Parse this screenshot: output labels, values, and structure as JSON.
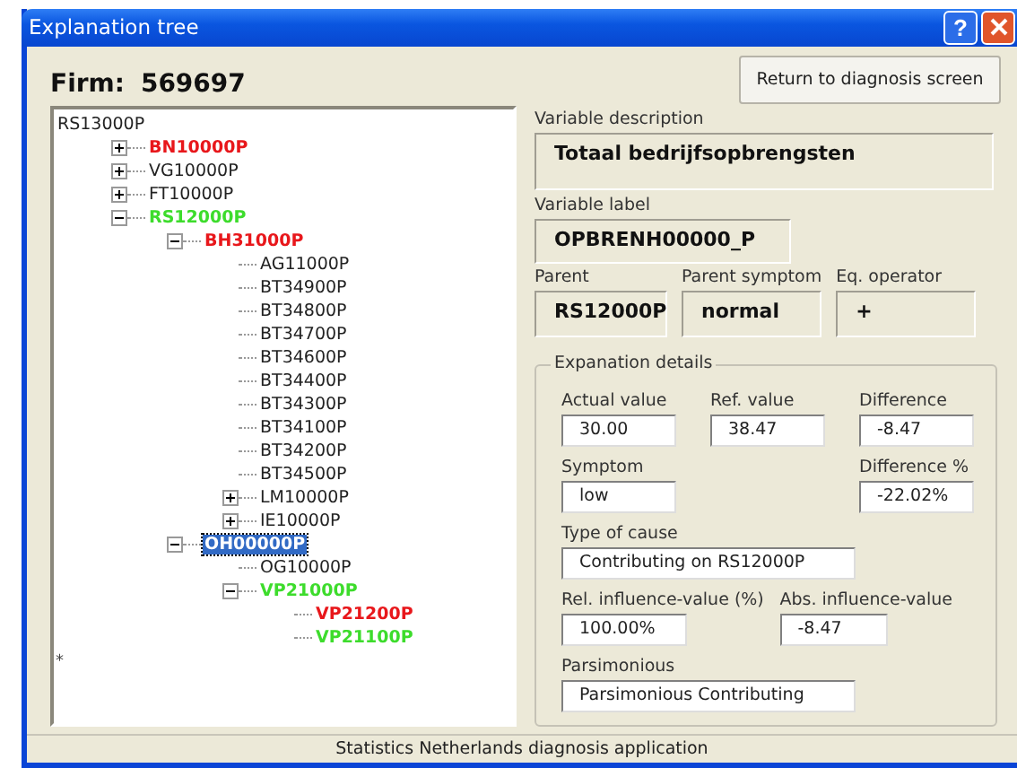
{
  "window": {
    "title": "Explanation tree",
    "help_button": "?"
  },
  "firm": {
    "label": "Firm:",
    "value": "569697"
  },
  "tree": {
    "end_mark": "*",
    "items": [
      {
        "label": "RS13000P",
        "selected": false,
        "children": [
          {
            "label": "BN10000P",
            "color": "#e8171b",
            "selected": false,
            "expanded": false
          },
          {
            "label": "VG10000P",
            "selected": false,
            "expanded": false
          },
          {
            "label": "FT10000P",
            "selected": false,
            "expanded": false
          },
          {
            "label": "RS12000P",
            "color": "#3ddc2c",
            "selected": false,
            "expanded": true,
            "children": [
              {
                "label": "BH31000P",
                "color": "#e8171b",
                "selected": false,
                "expanded": true,
                "children": [
                  {
                    "label": "AG11000P",
                    "selected": false
                  },
                  {
                    "label": "BT34900P",
                    "selected": false
                  },
                  {
                    "label": "BT34800P",
                    "selected": false
                  },
                  {
                    "label": "BT34700P",
                    "selected": false
                  },
                  {
                    "label": "BT34600P",
                    "selected": false
                  },
                  {
                    "label": "BT34400P",
                    "selected": false
                  },
                  {
                    "label": "BT34300P",
                    "selected": false
                  },
                  {
                    "label": "BT34100P",
                    "selected": false
                  },
                  {
                    "label": "BT34200P",
                    "selected": false
                  },
                  {
                    "label": "BT34500P",
                    "selected": false
                  },
                  {
                    "label": "LM10000P",
                    "selected": false,
                    "expanded": false
                  },
                  {
                    "label": "IE10000P",
                    "selected": false,
                    "expanded": false
                  }
                ]
              },
              {
                "label": "OH00000P",
                "selected": true,
                "expanded": true,
                "children": [
                  {
                    "label": "OG10000P",
                    "selected": false
                  },
                  {
                    "label": "VP21000P",
                    "color": "#3ddc2c",
                    "selected": false,
                    "expanded": true,
                    "children": [
                      {
                        "label": "VP21200P",
                        "color": "#e8171b",
                        "selected": false
                      },
                      {
                        "label": "VP21100P",
                        "color": "#3ddc2c",
                        "selected": false
                      }
                    ]
                  }
                ]
              }
            ]
          }
        ]
      }
    ]
  },
  "return_button": "Return to diagnosis screen",
  "variable_description": {
    "label": "Variable description",
    "value": "Totaal bedrijfsopbrengsten"
  },
  "variable_label": {
    "label": "Variable label",
    "value": "OPBRENH00000_P"
  },
  "parent": {
    "label": "Parent",
    "value": "RS12000P"
  },
  "parent_symptom": {
    "label": "Parent symptom",
    "value": "normal"
  },
  "eq_operator": {
    "label": "Eq. operator",
    "value": "+"
  },
  "details": {
    "title": "Expanation details",
    "actual_value": {
      "label": "Actual value",
      "value": "30.00"
    },
    "ref_value": {
      "label": "Ref. value",
      "value": "38.47"
    },
    "difference": {
      "label": "Difference",
      "value": "-8.47"
    },
    "symptom": {
      "label": "Symptom",
      "value": "low"
    },
    "difference_pct": {
      "label": "Difference %",
      "value": "-22.02%"
    },
    "type_of_cause": {
      "label": "Type of cause",
      "value": "Contributing on RS12000P"
    },
    "rel_influence": {
      "label": "Rel. influence-value (%)",
      "value": "100.00%"
    },
    "abs_influence": {
      "label": "Abs. influence-value",
      "value": "-8.47"
    },
    "parsimonious": {
      "label": "Parsimonious",
      "value": "Parsimonious Contributing"
    }
  },
  "status_bar": "Statistics Netherlands diagnosis application"
}
